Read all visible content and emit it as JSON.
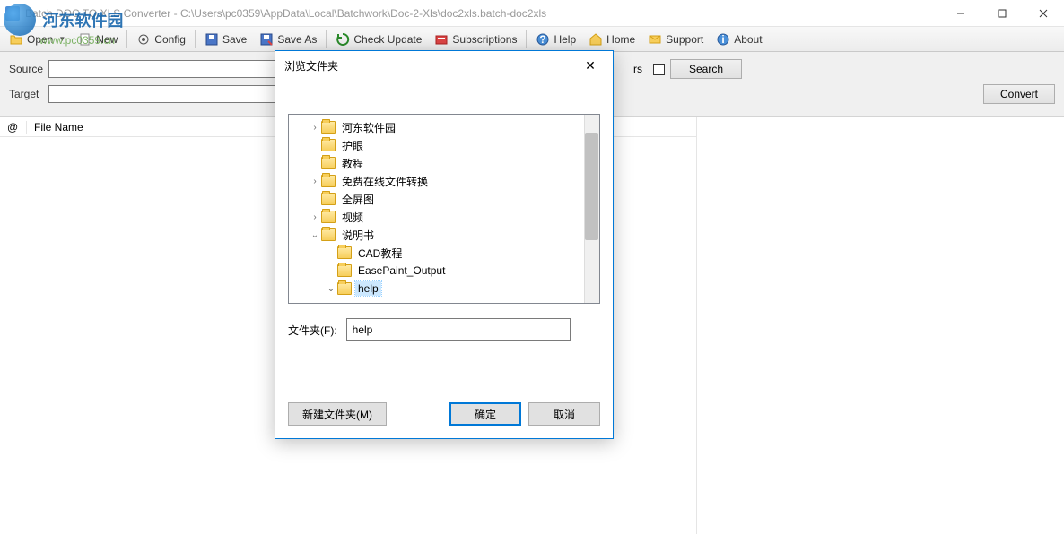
{
  "window": {
    "title": "Batch DOC TO XLS Converter - C:\\Users\\pc0359\\AppData\\Local\\Batchwork\\Doc-2-Xls\\doc2xls.batch-doc2xls"
  },
  "toolbar": {
    "open": "Open",
    "new": "New",
    "config": "Config",
    "save": "Save",
    "save_as": "Save As",
    "check_update": "Check Update",
    "subscriptions": "Subscriptions",
    "help": "Help",
    "home": "Home",
    "support": "Support",
    "about": "About"
  },
  "form": {
    "source_label": "Source",
    "source_value": "",
    "target_label": "Target",
    "target_value": "",
    "subfolders_label": "rs",
    "search_btn": "Search",
    "convert_btn": "Convert"
  },
  "list": {
    "col_at": "@",
    "col_filename": "File Name"
  },
  "dialog": {
    "title": "浏览文件夹",
    "folder_label": "文件夹(F):",
    "folder_value": "help",
    "new_folder_btn": "新建文件夹(M)",
    "ok_btn": "确定",
    "cancel_btn": "取消",
    "tree": [
      {
        "level": 1,
        "expander": ">",
        "label": "河东软件园"
      },
      {
        "level": 1,
        "expander": "",
        "label": "护眼"
      },
      {
        "level": 1,
        "expander": "",
        "label": "教程"
      },
      {
        "level": 1,
        "expander": ">",
        "label": "免费在线文件转换"
      },
      {
        "level": 1,
        "expander": "",
        "label": "全屏图"
      },
      {
        "level": 1,
        "expander": ">",
        "label": "视频"
      },
      {
        "level": 1,
        "expander": "v",
        "label": "说明书"
      },
      {
        "level": 2,
        "expander": "",
        "label": "CAD教程"
      },
      {
        "level": 2,
        "expander": "",
        "label": "EasePaint_Output"
      },
      {
        "level": 2,
        "expander": "v",
        "label": "help",
        "selected": true
      }
    ]
  },
  "watermark": {
    "text": "河东软件园",
    "url": "www.pc0359.cn"
  }
}
